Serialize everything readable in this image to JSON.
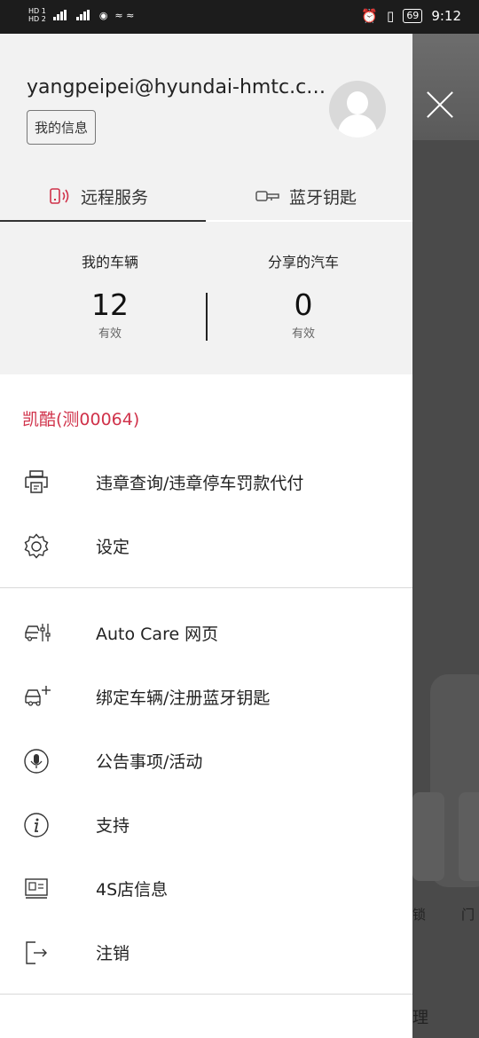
{
  "status_bar": {
    "left_text": "HD HD 4G 4G",
    "battery": "69",
    "time": "9:12"
  },
  "profile": {
    "email": "yangpeipei@hyundai-hmtc.c…",
    "my_info_button": "我的信息"
  },
  "tabs": [
    {
      "label": "远程服务",
      "active": true
    },
    {
      "label": "蓝牙钥匙",
      "active": false
    }
  ],
  "stats": {
    "my_vehicles": {
      "label": "我的车辆",
      "count": "12",
      "status": "有效"
    },
    "shared_cars": {
      "label": "分享的汽车",
      "count": "0",
      "status": "有效"
    }
  },
  "vehicle_name": "凯酷(测00064)",
  "menu_section_1": [
    {
      "label": "违章查询/违章停车罚款代付",
      "icon": "printer-icon"
    },
    {
      "label": "设定",
      "icon": "gear-icon"
    }
  ],
  "menu_section_2": [
    {
      "label": "Auto Care 网页",
      "icon": "car-care-icon"
    },
    {
      "label": "绑定车辆/注册蓝牙钥匙",
      "icon": "car-add-icon"
    },
    {
      "label": "公告事项/活动",
      "icon": "microphone-icon"
    },
    {
      "label": "支持",
      "icon": "info-icon"
    },
    {
      "label": "4S店信息",
      "icon": "id-card-icon"
    },
    {
      "label": "注销",
      "icon": "logout-icon"
    }
  ],
  "background": {
    "label_lock": "锁",
    "label_partial": "门",
    "label_bottom": "理"
  },
  "colors": {
    "accent_red": "#d0324a",
    "overlay": "#3a3a3a"
  }
}
